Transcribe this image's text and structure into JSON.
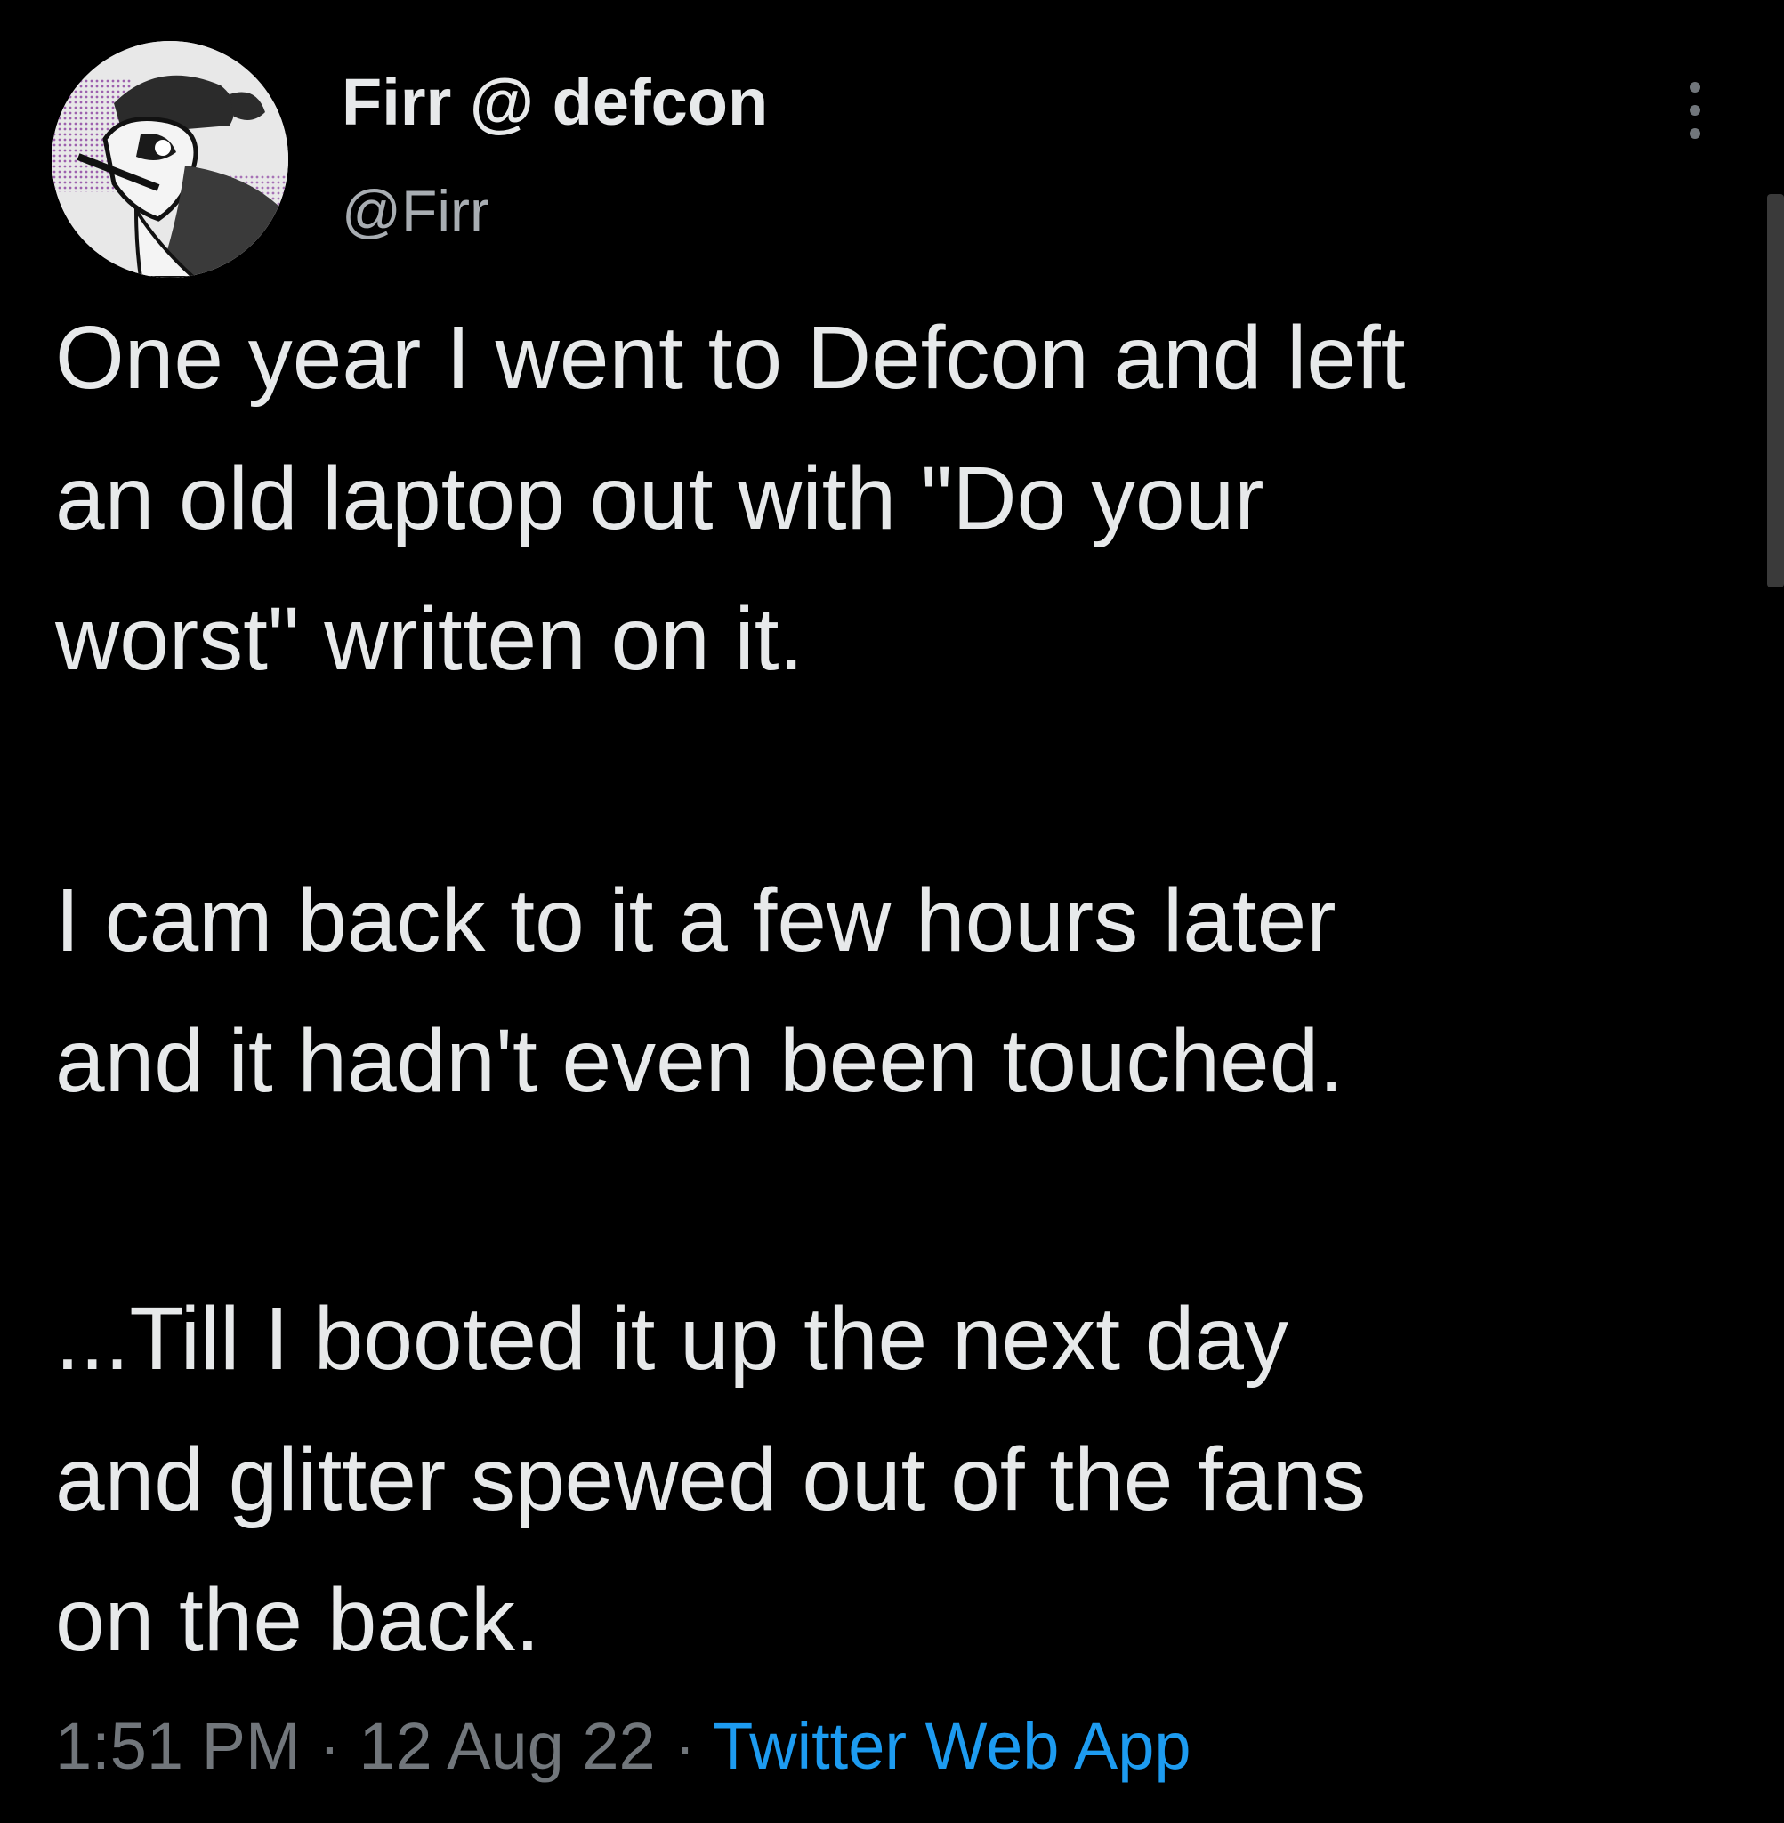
{
  "author": {
    "display_name": "Firr @ defcon",
    "handle": "@Firr",
    "avatar_icon": "avatar-illustration"
  },
  "tweet": {
    "paragraphs": [
      {
        "lines": [
          "One year I went to Defcon and left",
          "an old laptop out with \"Do your",
          "worst\" written on it."
        ]
      },
      {
        "lines": [
          "I cam back to it a few hours later",
          "and it hadn't even been touched."
        ]
      },
      {
        "lines": [
          "...Till I booted it up the next day",
          "and glitter spewed out of the fans",
          "on the back."
        ]
      }
    ],
    "time": "1:51 PM",
    "separator": " · ",
    "date": "12 Aug 22",
    "source": "Twitter Web App"
  },
  "colors": {
    "background": "#000000",
    "text": "#e7e9ea",
    "secondary_text": "#71767b",
    "link": "#1d9bf0"
  },
  "icons": {
    "more": "more-vertical-icon"
  }
}
